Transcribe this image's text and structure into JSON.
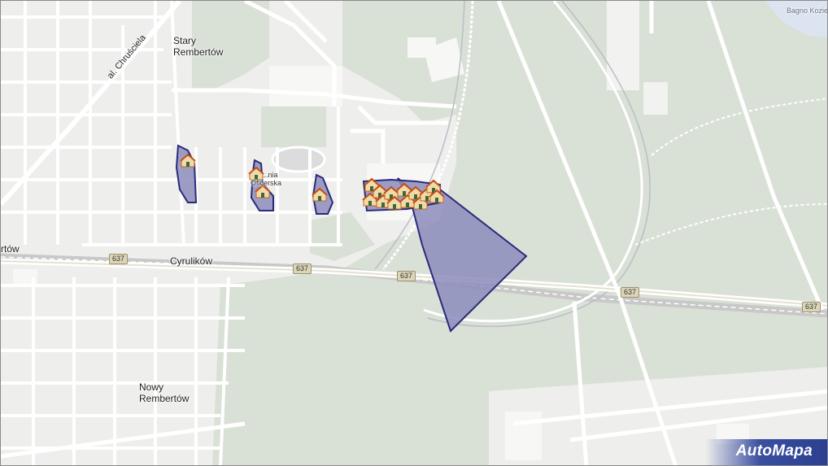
{
  "map": {
    "labels": {
      "stary_rembertow": [
        "Stary",
        "Rembertów"
      ],
      "nowy_rembertow": [
        "Nowy",
        "Rembertów"
      ],
      "cyrulikow": "Cyrulików",
      "rembertow_edge": "rtów",
      "al_chrusciela": "al. Chruściela",
      "kolonia_oficerska": [
        "...nia",
        "Oficerska"
      ],
      "bagno_kozie": "Bagno Kozie"
    },
    "road_shields": [
      "637",
      "637",
      "637",
      "637",
      "637"
    ],
    "brand": "AutoMapa",
    "colors": {
      "forest": "#d9e0d6",
      "urban": "#eeeeec",
      "road": "#ffffff",
      "railway": "#c9c9c9",
      "highlight_fill": "#8c8cbd",
      "highlight_stroke": "#2a2a7a",
      "water": "#dde4f1"
    },
    "icons": [
      "house-marker-icon"
    ]
  }
}
